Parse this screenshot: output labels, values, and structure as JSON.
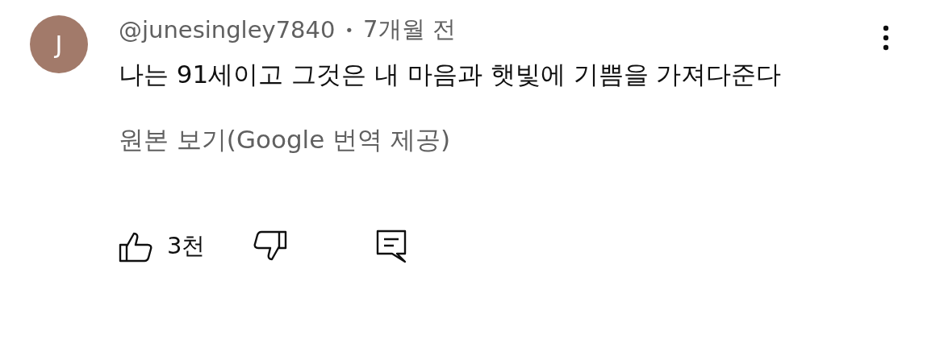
{
  "comment": {
    "avatar_letter": "J",
    "author": "@junesingley7840",
    "separator": "•",
    "time": "7개월 전",
    "text": "나는 91세이고 그것은 내 마음과 햇빛에 기쁨을 가져다준다",
    "translation_link": "원본 보기(Google 번역 제공)",
    "like_count": "3천"
  }
}
